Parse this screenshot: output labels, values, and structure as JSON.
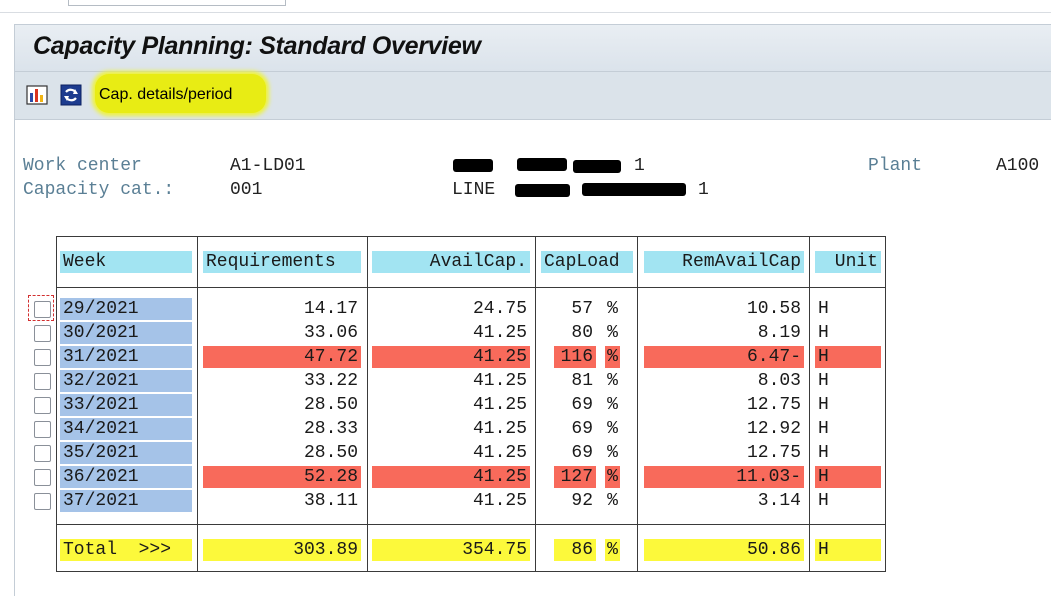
{
  "window": {
    "title": "Capacity Planning: Standard Overview"
  },
  "toolbar": {
    "icons": [
      "chart-icon",
      "refresh-icon"
    ],
    "cap_details_label": "Cap. details/period"
  },
  "header": {
    "work_center_label": "Work center",
    "work_center_value": "A1-LD01",
    "work_center_desc_suffix": "1",
    "capacity_cat_label": "Capacity cat.:",
    "capacity_cat_value": "001",
    "capacity_desc_prefix": "LINE",
    "capacity_desc_suffix": "1",
    "plant_label": "Plant",
    "plant_value": "A100"
  },
  "table": {
    "columns": [
      "Week",
      "Requirements",
      "AvailCap.",
      "CapLoad",
      "RemAvailCap",
      "Unit"
    ],
    "rows": [
      {
        "week": "29/2021",
        "req": "14.17",
        "avail": "24.75",
        "load": "57",
        "pct": "%",
        "rem": "10.58",
        "unit": "H",
        "over": false
      },
      {
        "week": "30/2021",
        "req": "33.06",
        "avail": "41.25",
        "load": "80",
        "pct": "%",
        "rem": "8.19",
        "unit": "H",
        "over": false
      },
      {
        "week": "31/2021",
        "req": "47.72",
        "avail": "41.25",
        "load": "116",
        "pct": "%",
        "rem": "6.47-",
        "unit": "H",
        "over": true
      },
      {
        "week": "32/2021",
        "req": "33.22",
        "avail": "41.25",
        "load": "81",
        "pct": "%",
        "rem": "8.03",
        "unit": "H",
        "over": false
      },
      {
        "week": "33/2021",
        "req": "28.50",
        "avail": "41.25",
        "load": "69",
        "pct": "%",
        "rem": "12.75",
        "unit": "H",
        "over": false
      },
      {
        "week": "34/2021",
        "req": "28.33",
        "avail": "41.25",
        "load": "69",
        "pct": "%",
        "rem": "12.92",
        "unit": "H",
        "over": false
      },
      {
        "week": "35/2021",
        "req": "28.50",
        "avail": "41.25",
        "load": "69",
        "pct": "%",
        "rem": "12.75",
        "unit": "H",
        "over": false
      },
      {
        "week": "36/2021",
        "req": "52.28",
        "avail": "41.25",
        "load": "127",
        "pct": "%",
        "rem": "11.03-",
        "unit": "H",
        "over": true
      },
      {
        "week": "37/2021",
        "req": "38.11",
        "avail": "41.25",
        "load": "92",
        "pct": "%",
        "rem": "3.14",
        "unit": "H",
        "over": false
      }
    ],
    "total": {
      "label": "Total  >>>",
      "req": "303.89",
      "avail": "354.75",
      "load": "86",
      "pct": "%",
      "rem": "50.86",
      "unit": "H"
    }
  },
  "colors": {
    "overload": "#f86a5b",
    "total": "#fcf93b",
    "header": "#a2e4f2",
    "week": "#a5c3e8"
  }
}
